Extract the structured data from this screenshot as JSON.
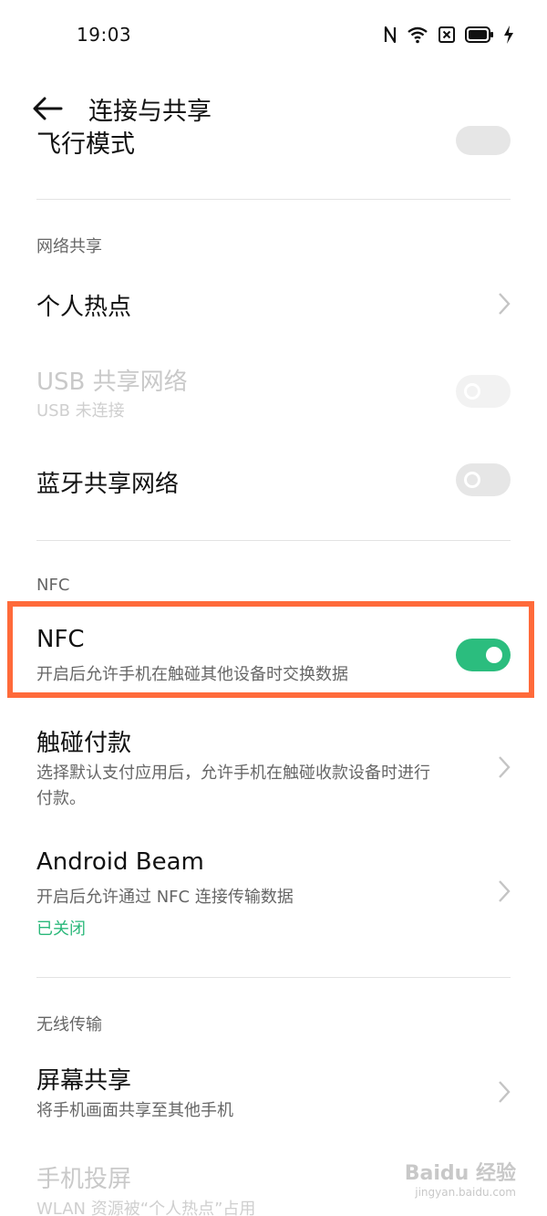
{
  "status_bar": {
    "time": "19:03"
  },
  "header": {
    "title": "连接与共享"
  },
  "partial_top": {
    "label": "飞行模式"
  },
  "sections": {
    "network_sharing": "网络共享",
    "nfc": "NFC",
    "wireless": "无线传输"
  },
  "items": {
    "hotspot": {
      "label": "个人热点"
    },
    "usb": {
      "label": "USB 共享网络",
      "sub": "USB 未连接"
    },
    "bluetooth": {
      "label": "蓝牙共享网络"
    },
    "nfc": {
      "label": "NFC",
      "sub": "开启后允许手机在触碰其他设备时交换数据",
      "enabled": true
    },
    "tap_pay": {
      "label": "触碰付款",
      "sub1": "选择默认支付应用后，允许手机在触碰收款设备时进行",
      "sub2": "付款。"
    },
    "android_beam": {
      "label": "Android Beam",
      "sub": "开启后允许通过 NFC 连接传输数据",
      "status": "已关闭"
    },
    "screen_share": {
      "label": "屏幕共享",
      "sub": "将手机画面共享至其他手机"
    },
    "cast": {
      "label": "手机投屏",
      "sub": "WLAN 资源被“个人热点”占用"
    }
  },
  "watermark": {
    "brand": "Baidu 经验",
    "url": "jingyan.baidu.com"
  },
  "colors": {
    "accent_green": "#2bbd7e",
    "highlight": "#ff6a3a"
  }
}
